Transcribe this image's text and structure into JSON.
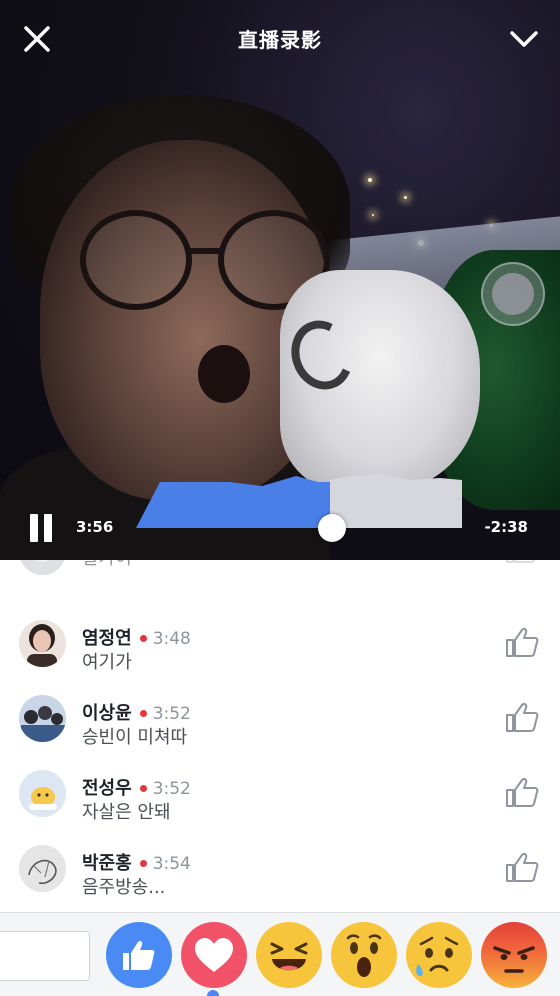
{
  "header": {
    "title": "直播录影"
  },
  "player": {
    "elapsed": "3:56",
    "remaining": "-2:38",
    "progress_fraction": 0.6
  },
  "comments": [
    {
      "name": "",
      "time": "",
      "text": "갈가여"
    },
    {
      "name": "염정연",
      "time": "3:48",
      "text": "여기가"
    },
    {
      "name": "이상윤",
      "time": "3:52",
      "text": "승빈이 미쳐따"
    },
    {
      "name": "전성우",
      "time": "3:52",
      "text": "자살은 안돼"
    },
    {
      "name": "박준홍",
      "time": "3:54",
      "text": "음주방송..."
    }
  ],
  "reactions": [
    {
      "icon": "like-icon",
      "color": "#4a8af4"
    },
    {
      "icon": "love-icon",
      "color": "#f25268"
    },
    {
      "icon": "haha-icon",
      "color": "#f7c53b"
    },
    {
      "icon": "wow-icon",
      "color": "#f7c53b"
    },
    {
      "icon": "sad-icon",
      "color": "#f7c53b"
    },
    {
      "icon": "angry-icon",
      "color": "#f0683c"
    }
  ],
  "colors": {
    "accent": "#4a7fe8",
    "live_dot": "#e8353b"
  }
}
